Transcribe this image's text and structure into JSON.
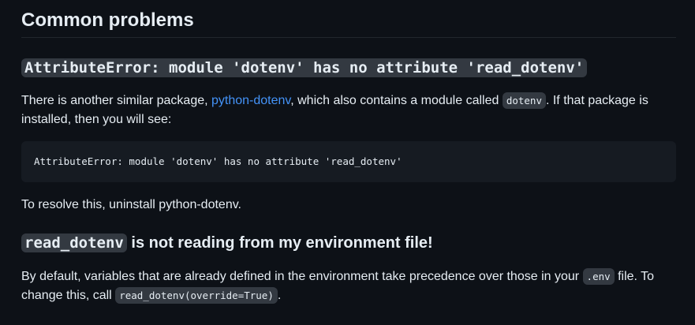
{
  "section": {
    "title": "Common problems"
  },
  "problem1": {
    "heading_code": "AttributeError: module 'dotenv' has no attribute 'read_dotenv'",
    "para_part1": "There is another similar package, ",
    "link_text": "python-dotenv",
    "para_part2": ", which also contains a module called ",
    "inline_code": "dotenv",
    "para_part3": ". If that package is installed, then you will see:",
    "code_block": "AttributeError: module 'dotenv' has no attribute 'read_dotenv'",
    "resolution": "To resolve this, uninstall python-dotenv."
  },
  "problem2": {
    "heading_code": "read_dotenv",
    "heading_text": " is not reading from my environment file!",
    "para_part1": "By default, variables that are already defined in the environment take precedence over those in your ",
    "inline_code1": ".env",
    "para_part2": " file. To change this, call ",
    "inline_code2": "read_dotenv(override=True)",
    "para_part3": "."
  }
}
